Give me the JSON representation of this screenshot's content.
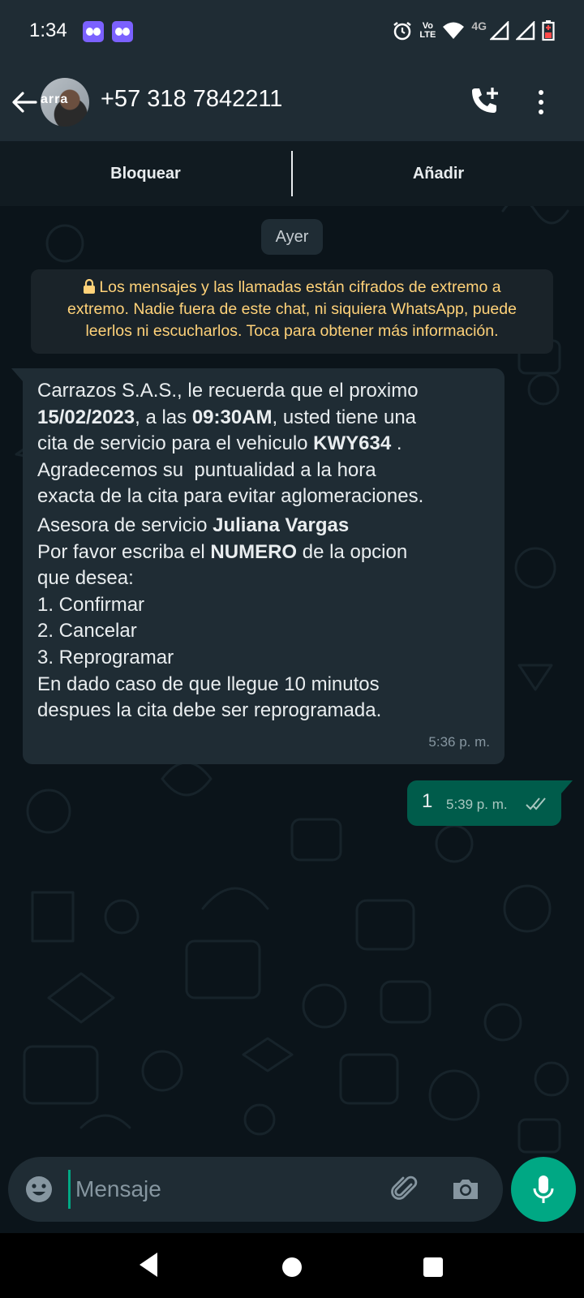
{
  "status_bar": {
    "time": "1:34",
    "network_type": "4G",
    "volte_line1": "Vo",
    "volte_line2": "LTE",
    "icons": [
      "app-notification-icon",
      "app-notification-icon",
      "alarm-icon",
      "volte-icon",
      "wifi-icon",
      "signal-icon",
      "signal-icon",
      "battery-icon"
    ]
  },
  "header": {
    "contact": "+57 318 7842211",
    "avatar_text": "arra",
    "icons": [
      "back-arrow-icon",
      "add-call-icon",
      "more-vert-icon"
    ]
  },
  "action_bar": {
    "block_label": "Bloquear",
    "add_label": "Añadir"
  },
  "chat": {
    "date_chip": "Ayer",
    "encryption_notice": "Los mensajes y las llamadas están cifrados de extremo a extremo. Nadie fuera de este chat, ni siquiera WhatsApp, puede leerlos ni escucharlos. Toca para obtener más información.",
    "encryption_lines": [
      "Los mensajes y las llamadas están cifrados de extremo a",
      "extremo. Nadie fuera de este chat, ni siquiera WhatsApp, puede",
      "leerlos ni escucharlos. Toca para obtener más información."
    ],
    "incoming": {
      "time": "5:36 p. m.",
      "l1": "Carrazos S.A.S., le recuerda que el proximo",
      "l2_date": "15/02/2023",
      "l2_mid": ", a las ",
      "l2_hour": "09:30AM",
      "l2_end": ", usted tiene una",
      "l3_start": "cita de servicio para el vehiculo ",
      "l3_plate": "KWY634",
      "l3_end": " .",
      "l4": "Agradecemos su  puntualidad a la hora",
      "l5": "exacta de la cita para evitar aglomeraciones.",
      "l6_start": "Asesora de servicio ",
      "l6_name": "Juliana Vargas",
      "l7_start": "Por favor escriba el ",
      "l7_bold": "NUMERO",
      "l7_end": " de la opcion",
      "l8": "que desea:",
      "l9": "1. Confirmar",
      "l10": "2. Cancelar",
      "l11": "3. Reprogramar",
      "l12": "En dado caso de que llegue 10 minutos",
      "l13": "despues la cita debe ser reprogramada."
    },
    "outgoing": {
      "text": "1",
      "time": "5:39 p. m.",
      "status": "read"
    }
  },
  "input_bar": {
    "placeholder": "Mensaje",
    "value": "",
    "icons": [
      "emoji-icon",
      "attach-icon",
      "camera-icon",
      "mic-icon"
    ]
  },
  "colors": {
    "background": "#0b141a",
    "header": "#1f2c34",
    "incoming_bubble": "#1f2c34",
    "outgoing_bubble": "#005c4b",
    "accent": "#00a884",
    "encryption_text": "#ffd279"
  }
}
